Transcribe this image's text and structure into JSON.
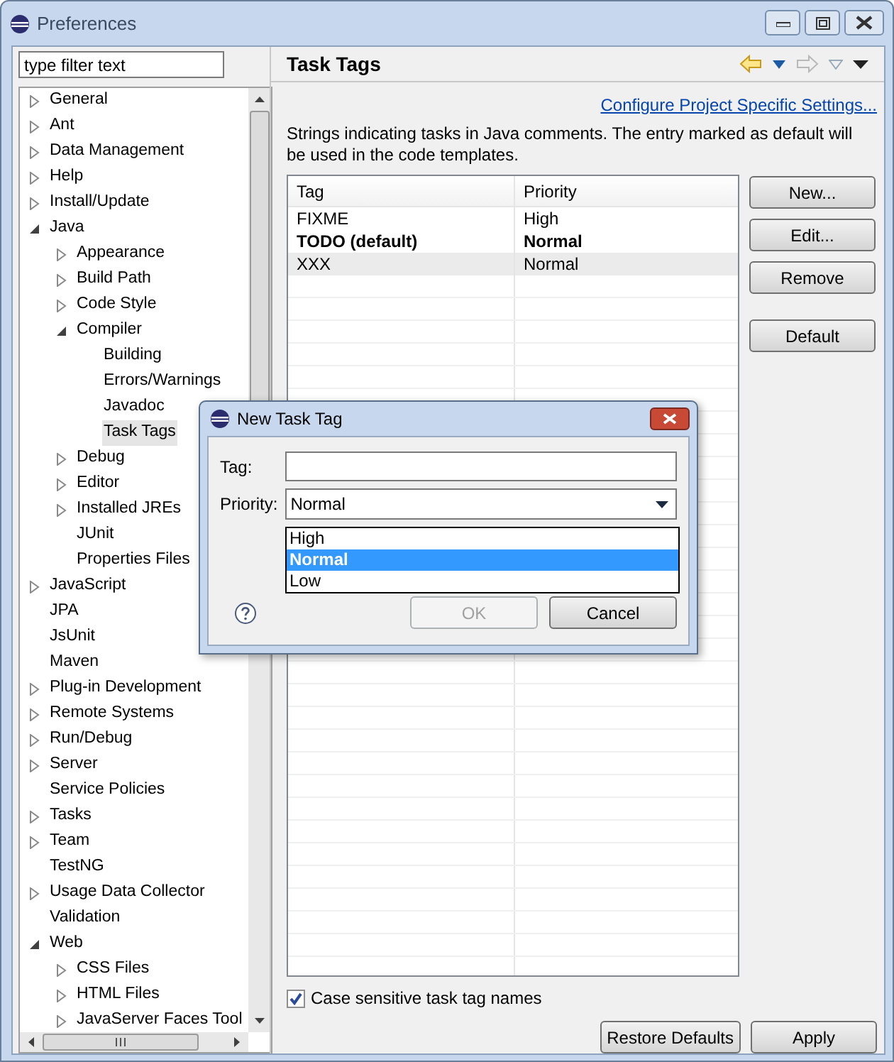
{
  "window": {
    "title": "Preferences"
  },
  "filter": {
    "value": "type filter text"
  },
  "tree": [
    {
      "label": "General",
      "kind": "collapsed",
      "selected": false
    },
    {
      "label": "Ant",
      "kind": "collapsed",
      "selected": false
    },
    {
      "label": "Data Management",
      "kind": "collapsed",
      "selected": false
    },
    {
      "label": "Help",
      "kind": "collapsed",
      "selected": false
    },
    {
      "label": "Install/Update",
      "kind": "collapsed",
      "selected": false
    },
    {
      "label": "Java",
      "kind": "expanded",
      "selected": false,
      "children": [
        {
          "label": "Appearance",
          "kind": "collapsed",
          "selected": false
        },
        {
          "label": "Build Path",
          "kind": "collapsed",
          "selected": false
        },
        {
          "label": "Code Style",
          "kind": "collapsed",
          "selected": false
        },
        {
          "label": "Compiler",
          "kind": "expanded",
          "selected": false,
          "children": [
            {
              "label": "Building",
              "selected": false
            },
            {
              "label": "Errors/Warnings",
              "selected": false
            },
            {
              "label": "Javadoc",
              "selected": false
            },
            {
              "label": "Task Tags",
              "selected": true
            }
          ]
        },
        {
          "label": "Debug",
          "kind": "collapsed",
          "selected": false
        },
        {
          "label": "Editor",
          "kind": "collapsed",
          "selected": false
        },
        {
          "label": "Installed JREs",
          "kind": "collapsed",
          "selected": false
        },
        {
          "label": "JUnit",
          "selected": false
        },
        {
          "label": "Properties Files",
          "selected": false
        }
      ]
    },
    {
      "label": "JavaScript",
      "kind": "collapsed",
      "selected": false
    },
    {
      "label": "JPA",
      "selected": false
    },
    {
      "label": "JsUnit",
      "selected": false
    },
    {
      "label": "Maven",
      "selected": false
    },
    {
      "label": "Plug-in Development",
      "kind": "collapsed",
      "selected": false
    },
    {
      "label": "Remote Systems",
      "kind": "collapsed",
      "selected": false
    },
    {
      "label": "Run/Debug",
      "kind": "collapsed",
      "selected": false
    },
    {
      "label": "Server",
      "kind": "collapsed",
      "selected": false
    },
    {
      "label": "Service Policies",
      "selected": false
    },
    {
      "label": "Tasks",
      "kind": "collapsed",
      "selected": false
    },
    {
      "label": "Team",
      "kind": "collapsed",
      "selected": false
    },
    {
      "label": "TestNG",
      "selected": false
    },
    {
      "label": "Usage Data Collector",
      "kind": "collapsed",
      "selected": false
    },
    {
      "label": "Validation",
      "selected": false
    },
    {
      "label": "Web",
      "kind": "expanded",
      "selected": false,
      "children": [
        {
          "label": "CSS Files",
          "kind": "collapsed",
          "selected": false
        },
        {
          "label": "HTML Files",
          "kind": "collapsed",
          "selected": false
        },
        {
          "label": "JavaServer Faces Tool",
          "kind": "collapsed",
          "selected": false
        }
      ]
    }
  ],
  "page": {
    "title": "Task Tags",
    "link": "Configure Project Specific Settings...",
    "description": "Strings indicating tasks in Java comments. The entry marked as default will be used in the code templates.",
    "table": {
      "columns": [
        "Tag",
        "Priority"
      ],
      "rows": [
        {
          "cells": [
            "FIXME",
            "High"
          ],
          "default": false,
          "selected": false
        },
        {
          "cells": [
            "TODO (default)",
            "Normal"
          ],
          "default": true,
          "selected": false
        },
        {
          "cells": [
            "XXX",
            "Normal"
          ],
          "default": false,
          "selected": true
        }
      ]
    },
    "side_buttons": [
      "New...",
      "Edit...",
      "Remove",
      "Default"
    ],
    "checkbox": {
      "label": "Case sensitive task tag names",
      "checked": true
    },
    "footer_buttons": [
      "Restore Defaults",
      "Apply"
    ]
  },
  "dialog": {
    "title": "New Task Tag",
    "tag_label": "Tag:",
    "priority_label": "Priority:",
    "priority_value": "Normal",
    "options": [
      {
        "label": "High",
        "selected": false
      },
      {
        "label": "Normal",
        "selected": true
      },
      {
        "label": "Low",
        "selected": false
      }
    ],
    "buttons": [
      {
        "label": "OK",
        "disabled": true
      },
      {
        "label": "Cancel",
        "disabled": false
      }
    ]
  }
}
